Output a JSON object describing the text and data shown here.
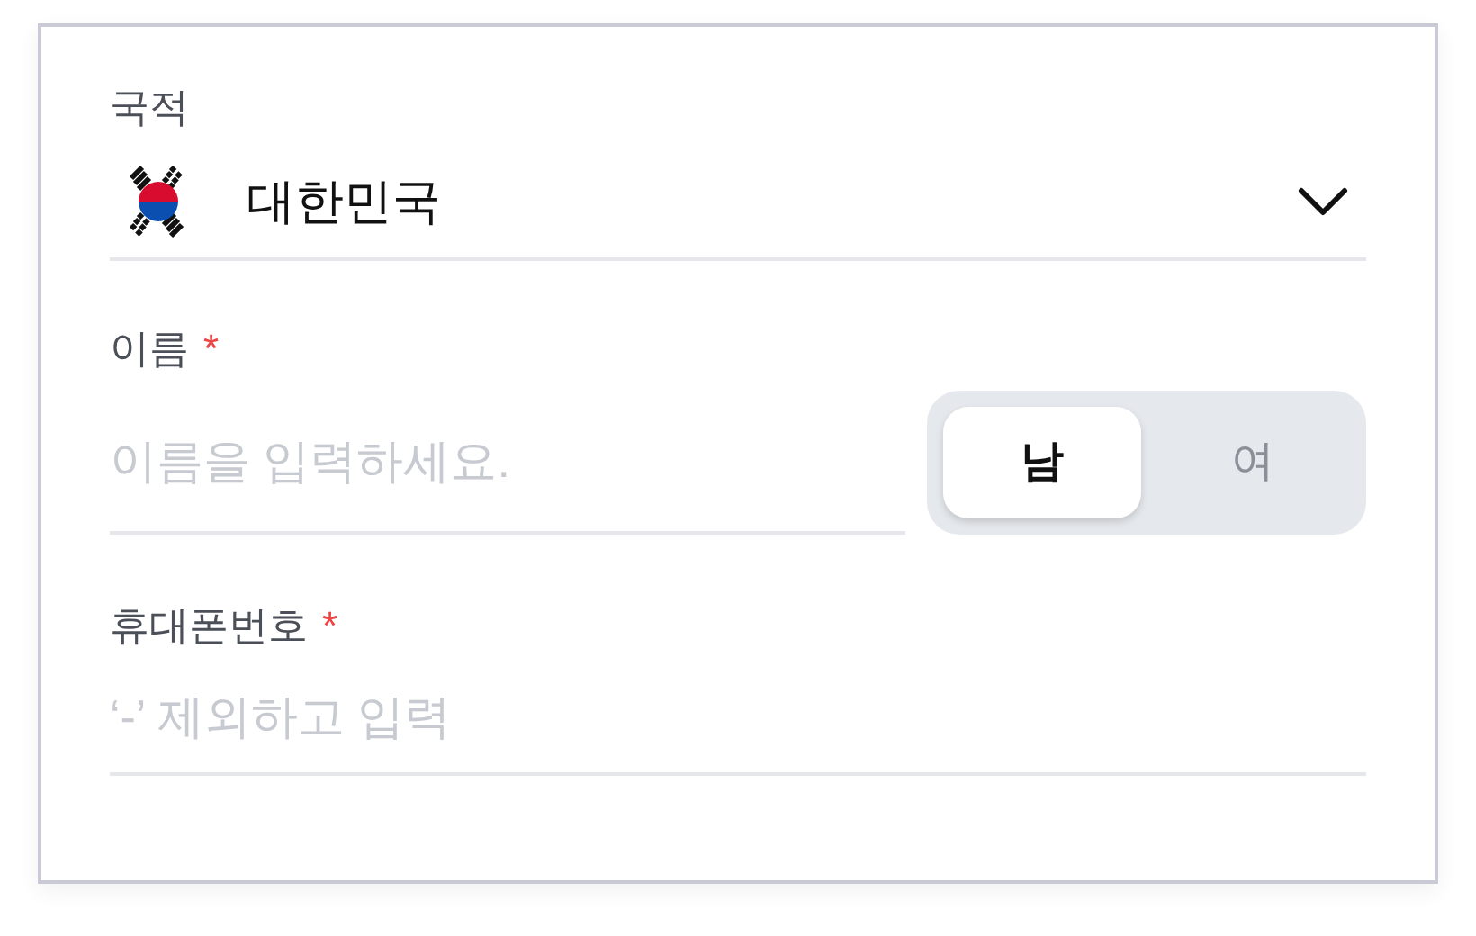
{
  "nationality": {
    "label": "국적",
    "value": "대한민국"
  },
  "name": {
    "label": "이름",
    "required_mark": "*",
    "placeholder": "이름을 입력하세요.",
    "gender_options": [
      {
        "label": "남",
        "selected": true
      },
      {
        "label": "여",
        "selected": false
      }
    ]
  },
  "phone": {
    "label": "휴대폰번호",
    "required_mark": "*",
    "placeholder": "‘-’ 제외하고 입력"
  }
}
